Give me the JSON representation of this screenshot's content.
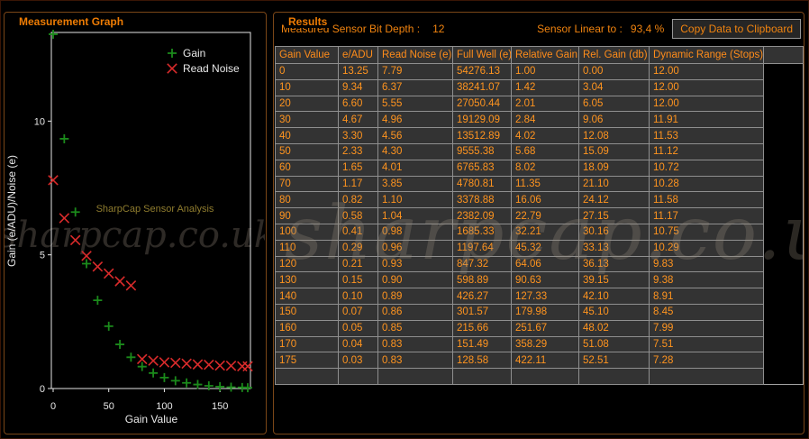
{
  "window_title": "SharpCap Sensor Analysis",
  "accent_color": "#ff8c1a",
  "watermark": {
    "text": "sharpcap.co.uk"
  },
  "graph_panel": {
    "title": "Measurement Graph",
    "annotation": "SharpCap Sensor Analysis"
  },
  "chart_data": {
    "type": "scatter",
    "title": "",
    "xlabel": "Gain Value",
    "ylabel": "Gain (e/ADU)/Noise (e)",
    "xlim": [
      0,
      178
    ],
    "ylim": [
      0,
      13.3
    ],
    "xticks": [
      0,
      50,
      100,
      150
    ],
    "yticks": [
      0,
      5,
      10
    ],
    "grid": false,
    "legend_position": "top-right",
    "annotations": [
      "SharpCap Sensor Analysis",
      "sharpcap.co.uk"
    ],
    "x": [
      0,
      10,
      20,
      30,
      40,
      50,
      60,
      70,
      80,
      90,
      100,
      110,
      120,
      130,
      140,
      150,
      160,
      170,
      175
    ],
    "series": [
      {
        "name": "Gain",
        "marker": "plus",
        "color": "#1b8a1b",
        "values": [
          13.25,
          9.34,
          6.6,
          4.67,
          3.3,
          2.33,
          1.65,
          1.17,
          0.82,
          0.58,
          0.41,
          0.29,
          0.21,
          0.15,
          0.1,
          0.07,
          0.05,
          0.04,
          0.03
        ]
      },
      {
        "name": "Read Noise",
        "marker": "x",
        "color": "#d92b2b",
        "values": [
          7.79,
          6.37,
          5.55,
          4.96,
          4.56,
          4.3,
          4.01,
          3.85,
          1.1,
          1.04,
          0.98,
          0.96,
          0.93,
          0.9,
          0.89,
          0.86,
          0.85,
          0.83,
          0.83
        ]
      }
    ]
  },
  "results_panel": {
    "title": "Results",
    "bit_depth_label": "Measured Sensor Bit Depth :",
    "bit_depth_value": "12",
    "linear_label": "Sensor Linear to :",
    "linear_value": "93,4 %",
    "copy_button_label": "Copy Data to Clipboard",
    "table": {
      "columns": [
        "Gain Value",
        "e/ADU",
        "Read Noise (e)",
        "Full Well (e)",
        "Relative Gain",
        "Rel. Gain (db)",
        "Dynamic Range (Stops)"
      ],
      "rows": [
        [
          "0",
          "13.25",
          "7.79",
          "54276.13",
          "1.00",
          "0.00",
          "12.00"
        ],
        [
          "10",
          "9.34",
          "6.37",
          "38241.07",
          "1.42",
          "3.04",
          "12.00"
        ],
        [
          "20",
          "6.60",
          "5.55",
          "27050.44",
          "2.01",
          "6.05",
          "12.00"
        ],
        [
          "30",
          "4.67",
          "4.96",
          "19129.09",
          "2.84",
          "9.06",
          "11.91"
        ],
        [
          "40",
          "3.30",
          "4.56",
          "13512.89",
          "4.02",
          "12.08",
          "11.53"
        ],
        [
          "50",
          "2.33",
          "4.30",
          "9555.38",
          "5.68",
          "15.09",
          "11.12"
        ],
        [
          "60",
          "1.65",
          "4.01",
          "6765.83",
          "8.02",
          "18.09",
          "10.72"
        ],
        [
          "70",
          "1.17",
          "3.85",
          "4780.81",
          "11.35",
          "21.10",
          "10.28"
        ],
        [
          "80",
          "0.82",
          "1.10",
          "3378.88",
          "16.06",
          "24.12",
          "11.58"
        ],
        [
          "90",
          "0.58",
          "1.04",
          "2382.09",
          "22.79",
          "27.15",
          "11.17"
        ],
        [
          "100",
          "0.41",
          "0.98",
          "1685.33",
          "32.21",
          "30.16",
          "10.75"
        ],
        [
          "110",
          "0.29",
          "0.96",
          "1197.64",
          "45.32",
          "33.13",
          "10.29"
        ],
        [
          "120",
          "0.21",
          "0.93",
          "847.32",
          "64.06",
          "36.13",
          "9.83"
        ],
        [
          "130",
          "0.15",
          "0.90",
          "598.89",
          "90.63",
          "39.15",
          "9.38"
        ],
        [
          "140",
          "0.10",
          "0.89",
          "426.27",
          "127.33",
          "42.10",
          "8.91"
        ],
        [
          "150",
          "0.07",
          "0.86",
          "301.57",
          "179.98",
          "45.10",
          "8.45"
        ],
        [
          "160",
          "0.05",
          "0.85",
          "215.66",
          "251.67",
          "48.02",
          "7.99"
        ],
        [
          "170",
          "0.04",
          "0.83",
          "151.49",
          "358.29",
          "51.08",
          "7.51"
        ],
        [
          "175",
          "0.03",
          "0.83",
          "128.58",
          "422.11",
          "52.51",
          "7.28"
        ]
      ]
    }
  }
}
